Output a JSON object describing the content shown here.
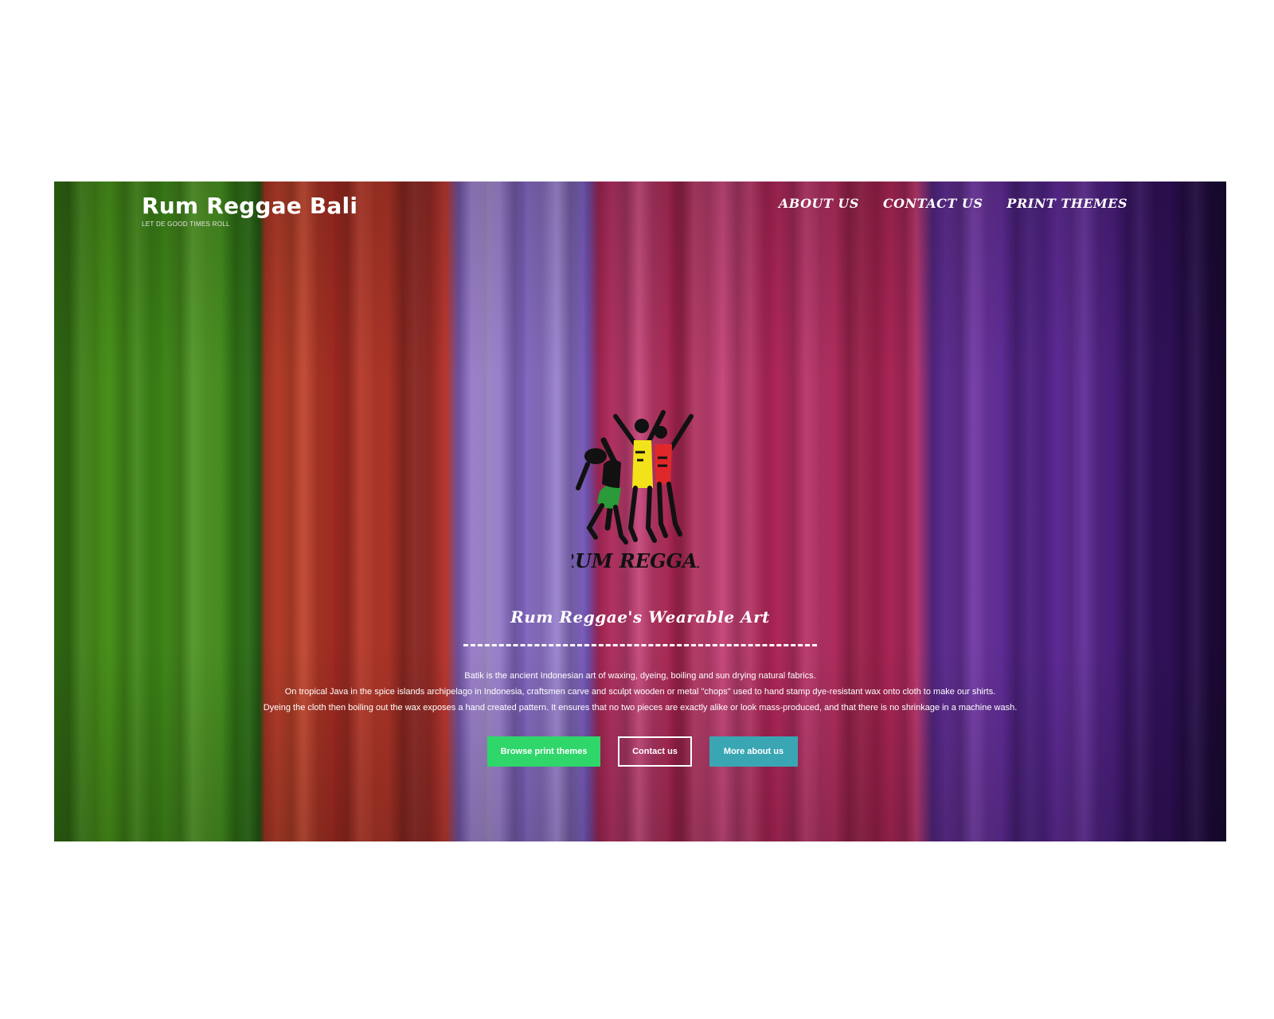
{
  "header": {
    "site_title": "Rum Reggae Bali",
    "tagline": "LET DE GOOD TIMES ROLL",
    "nav": [
      "About us",
      "Contact us",
      "Print themes"
    ]
  },
  "hero": {
    "logo_text": "RUM REGGAE",
    "title": "Rum Reggae's Wearable Art",
    "description": [
      "Batik is the ancient Indonesian art of waxing, dyeing, boiling and sun drying natural fabrics.",
      "On tropical Java in the spice islands archipelago in Indonesia, craftsmen carve and sculpt wooden or metal \"chops\" used to hand stamp dye-resistant wax onto cloth to make our shirts.",
      "Dyeing the cloth then boiling out the wax exposes a hand created pattern. It ensures that no two pieces are exactly alike or look mass-produced, and that there is no shrinkage in a machine wash."
    ],
    "buttons": {
      "browse": "Browse print themes",
      "contact": "Contact us",
      "more": "More about us"
    }
  },
  "colors": {
    "button_green": "#2fd66a",
    "button_teal": "#3aa6b4",
    "text": "#ffffff"
  }
}
